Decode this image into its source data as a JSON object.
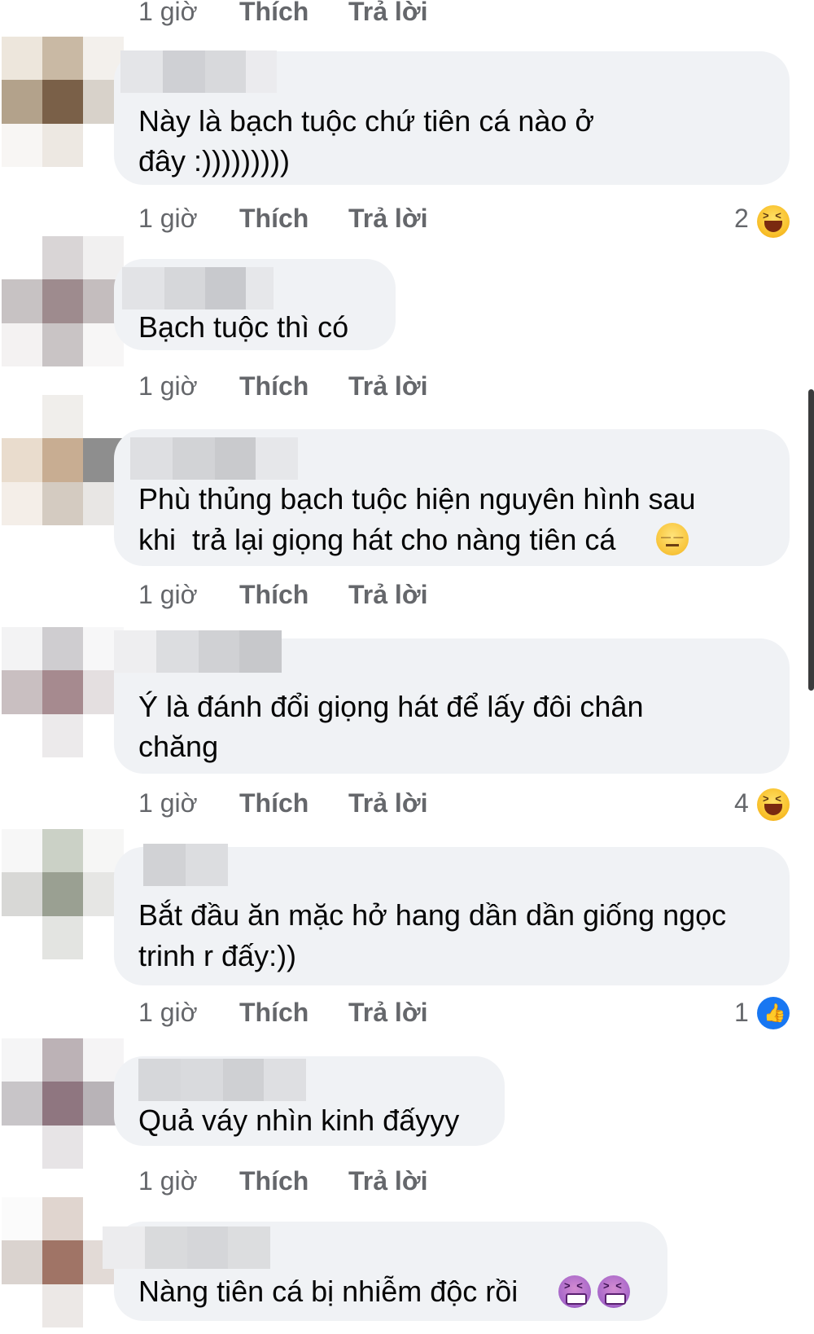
{
  "top_meta": {
    "time": "1 giờ",
    "like": "Thích",
    "reply": "Trả lời"
  },
  "comments": [
    {
      "text_lines": [
        "Này là bạch tuộc chứ tiên cá nào ở",
        "đây :)))))))))"
      ],
      "time": "1 giờ",
      "like": "Thích",
      "reply": "Trả lời",
      "reaction_count": "2",
      "reaction_icon": "haha-emoji-icon"
    },
    {
      "text_lines": [
        "Bạch tuộc thì có"
      ],
      "time": "1 giờ",
      "like": "Thích",
      "reply": "Trả lời"
    },
    {
      "text_lines": [
        "Phù thủng bạch tuộc hiện nguyên hình sau",
        "khi  trả lại giọng hát cho nàng tiên cá"
      ],
      "emoji": "expressionless-emoji",
      "time": "1 giờ",
      "like": "Thích",
      "reply": "Trả lời"
    },
    {
      "text_lines": [
        "Ý là đánh đổi giọng hát để lấy đôi chân",
        "chăng"
      ],
      "time": "1 giờ",
      "like": "Thích",
      "reply": "Trả lời",
      "reaction_count": "4",
      "reaction_icon": "haha-emoji-icon"
    },
    {
      "text_lines": [
        "Bắt đầu ăn mặc hở hang dần dần giống ngọc",
        "trinh r đấy:))"
      ],
      "time": "1 giờ",
      "like": "Thích",
      "reply": "Trả lời",
      "reaction_count": "1",
      "reaction_icon": "like-icon"
    },
    {
      "text_lines": [
        "Quả váy nhìn kinh đấyyy"
      ],
      "time": "1 giờ",
      "like": "Thích",
      "reply": "Trả lời"
    },
    {
      "text_lines": [
        "Nàng tiên cá bị nhiễm độc rồi"
      ],
      "emoji": "sick-emoji-x2"
    }
  ],
  "colors": {
    "bubble": "#f0f2f5",
    "meta_text": "#65676b",
    "like_blue": "#1877f2"
  }
}
